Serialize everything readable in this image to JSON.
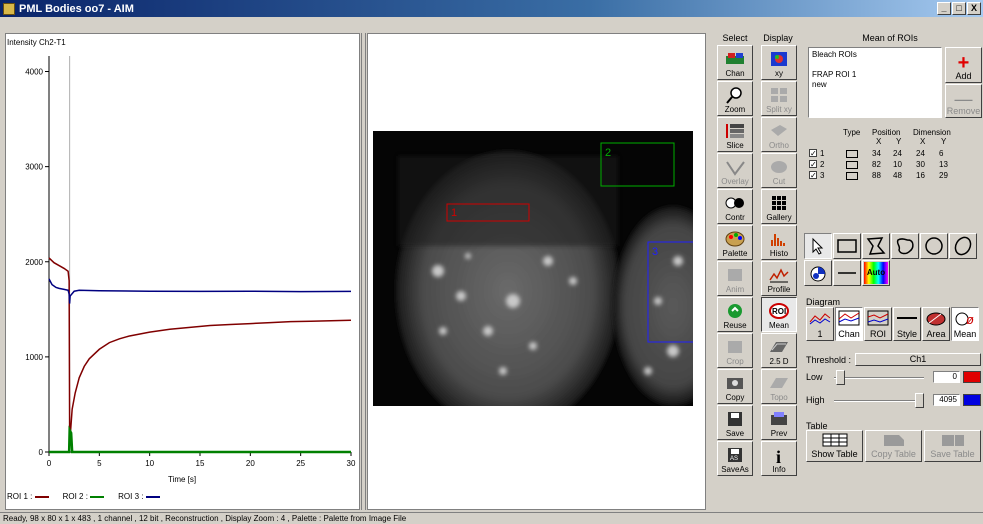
{
  "window": {
    "title": "PML Bodies oo7 - AIM",
    "controls": [
      "_",
      "□",
      "X"
    ]
  },
  "graph": {
    "ylabel": "Intensity Ch2-T1",
    "xlabel": "Time [s]",
    "legend": [
      {
        "label": "ROI 1 :",
        "color": "#800000"
      },
      {
        "label": "ROI 2 :",
        "color": "#008000"
      },
      {
        "label": "ROI 3 :",
        "color": "#000080"
      }
    ]
  },
  "chart_data": {
    "type": "line",
    "xlabel": "Time [s]",
    "ylabel": "Intensity Ch2-T1",
    "xlim": [
      0,
      30
    ],
    "ylim": [
      0,
      4100
    ],
    "xticks": [
      0,
      5,
      10,
      15,
      20,
      25,
      30
    ],
    "yticks": [
      0,
      1000,
      2000,
      3000,
      4000
    ],
    "series": [
      {
        "name": "ROI 1",
        "color": "#800000",
        "x": [
          0,
          0.5,
          1,
          1.5,
          1.9,
          2.0,
          2.05,
          2.1,
          2.3,
          2.6,
          3,
          3.5,
          4,
          5,
          6,
          7,
          8,
          10,
          12,
          14,
          16,
          18,
          20,
          22,
          24,
          26,
          28,
          30
        ],
        "y": [
          2040,
          1990,
          1960,
          1930,
          1900,
          1800,
          200,
          160,
          450,
          620,
          780,
          900,
          980,
          1080,
          1150,
          1190,
          1220,
          1260,
          1290,
          1310,
          1330,
          1340,
          1350,
          1360,
          1370,
          1375,
          1380,
          1385
        ]
      },
      {
        "name": "ROI 2",
        "color": "#008000",
        "x": [
          0,
          2.0,
          2.05,
          2.1,
          2.2,
          2.3,
          3,
          10,
          20,
          30
        ],
        "y": [
          0,
          0,
          230,
          220,
          200,
          0,
          0,
          0,
          0,
          0
        ]
      },
      {
        "name": "ROI 3",
        "color": "#000080",
        "x": [
          0,
          0.3,
          0.7,
          1,
          1.5,
          1.9,
          2.0,
          2.05,
          2.1,
          2.5,
          3,
          5,
          10,
          15,
          20,
          25,
          30
        ],
        "y": [
          1820,
          1760,
          1730,
          1720,
          1710,
          1700,
          1660,
          1560,
          1640,
          1690,
          1700,
          1695,
          1690,
          1688,
          1690,
          1686,
          1688
        ]
      }
    ]
  },
  "image": {
    "rois": [
      {
        "label": "1",
        "color": "#d00000"
      },
      {
        "label": "2",
        "color": "#00b000"
      },
      {
        "label": "3",
        "color": "#2020ff"
      }
    ]
  },
  "select": {
    "header": "Select",
    "buttons": [
      {
        "label": "Chan",
        "enabled": true
      },
      {
        "label": "Zoom",
        "enabled": true
      },
      {
        "label": "Slice",
        "enabled": true
      },
      {
        "label": "Overlay",
        "enabled": false
      },
      {
        "label": "Contr",
        "enabled": true
      },
      {
        "label": "Palette",
        "enabled": true
      },
      {
        "label": "Anim",
        "enabled": false
      },
      {
        "label": "Reuse",
        "enabled": true
      },
      {
        "label": "Crop",
        "enabled": false
      },
      {
        "label": "Copy",
        "enabled": true
      },
      {
        "label": "Save",
        "enabled": true
      },
      {
        "label": "SaveAs",
        "enabled": true
      }
    ]
  },
  "display": {
    "header": "Display",
    "buttons": [
      {
        "label": "xy",
        "enabled": true
      },
      {
        "label": "Split xy",
        "enabled": false
      },
      {
        "label": "Ortho",
        "enabled": false
      },
      {
        "label": "Cut",
        "enabled": false
      },
      {
        "label": "Gallery",
        "enabled": true
      },
      {
        "label": "Histo",
        "enabled": true
      },
      {
        "label": "Profile",
        "enabled": true
      },
      {
        "label": "Mean",
        "enabled": true
      },
      {
        "label": "2.5 D",
        "enabled": true
      },
      {
        "label": "Topo",
        "enabled": false
      },
      {
        "label": "Prev",
        "enabled": true
      },
      {
        "label": "Info",
        "enabled": true
      }
    ]
  },
  "mean": {
    "header": "Mean of ROIs",
    "list": [
      "Bleach ROIs",
      "",
      "FRAP ROI 1",
      "new"
    ],
    "add": "Add",
    "remove": "Remove",
    "table": {
      "headers": [
        "Type",
        "Position",
        "Dimension"
      ],
      "subheaders": [
        "X",
        "Y",
        "X",
        "Y"
      ],
      "rows": [
        {
          "id": "1",
          "checked": true,
          "px": "34",
          "py": "24",
          "dx": "24",
          "dy": "6"
        },
        {
          "id": "2",
          "checked": true,
          "px": "82",
          "py": "10",
          "dx": "30",
          "dy": "13"
        },
        {
          "id": "3",
          "checked": true,
          "px": "88",
          "py": "48",
          "dx": "16",
          "dy": "29"
        }
      ]
    },
    "auto": "Auto",
    "diagram": {
      "label": "Diagram",
      "buttons": [
        "1",
        "Chan",
        "ROI",
        "Style",
        "Area",
        "Mean"
      ]
    },
    "threshold": {
      "label": "Threshold :",
      "channel": "Ch1",
      "low_label": "Low",
      "low_value": "0",
      "high_label": "High",
      "high_value": "4095",
      "low_color": "#e00000",
      "high_color": "#0000e0"
    },
    "table_section": {
      "label": "Table",
      "show": "Show Table",
      "copy": "Copy Table",
      "save": "Save Table"
    }
  },
  "status": "Ready, 98 x 80 x 1 x 483 , 1 channel , 12 bit , Reconstruction , Display Zoom : 4 , Palette : Palette from Image File"
}
